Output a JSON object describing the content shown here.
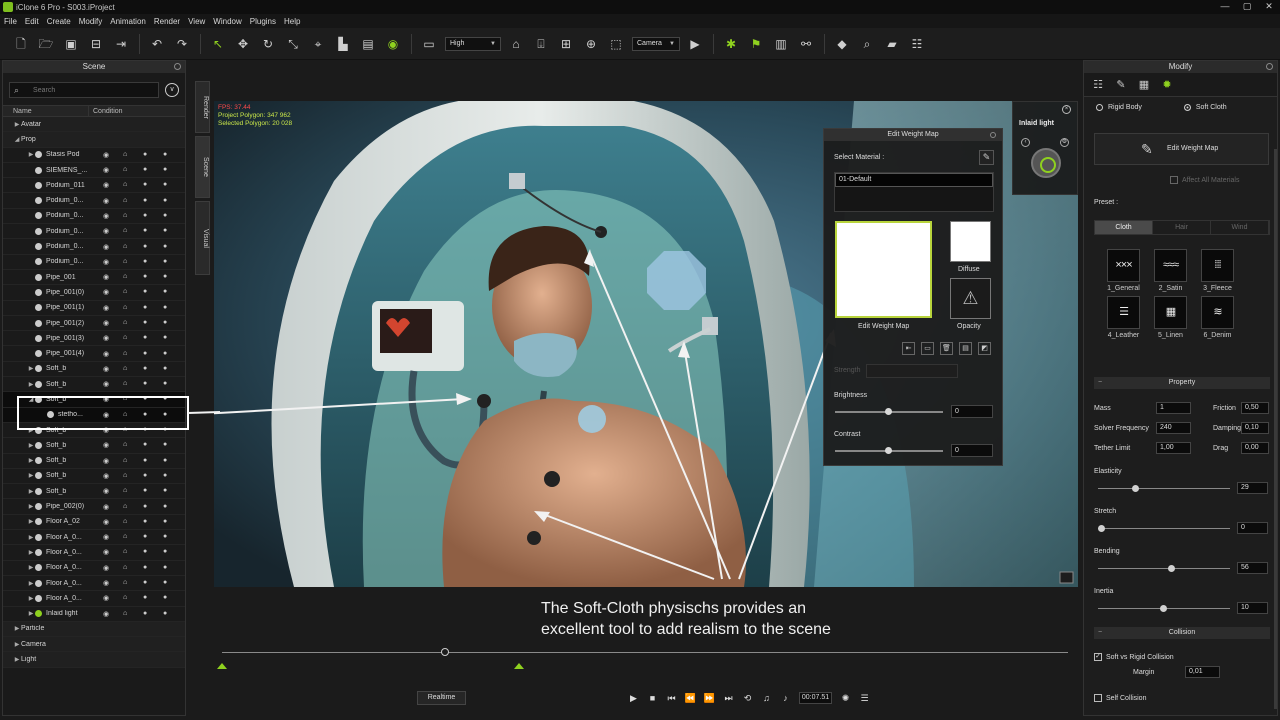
{
  "window": {
    "title": "iClone 6 Pro - S003.iProject",
    "controls": [
      "—",
      "▢",
      "✕"
    ]
  },
  "menu": [
    "File",
    "Edit",
    "Create",
    "Modify",
    "Animation",
    "Render",
    "View",
    "Window",
    "Plugins",
    "Help"
  ],
  "toolbar": {
    "quality": "High",
    "camera": "Camera"
  },
  "scene": {
    "title": "Scene",
    "search_placeholder": "Search",
    "columns": {
      "name": "Name",
      "condition": "Condition"
    },
    "rows": [
      {
        "name": "Avatar",
        "level": 0,
        "type": "category",
        "expanded": false
      },
      {
        "name": "Prop",
        "level": 0,
        "type": "category",
        "expanded": true
      },
      {
        "name": "Stasis Pod",
        "level": 1,
        "type": "item",
        "arrow": "▶"
      },
      {
        "name": "SIEMENS_...",
        "level": 1,
        "type": "item",
        "arrow": ""
      },
      {
        "name": "Podium_011",
        "level": 1,
        "type": "item",
        "arrow": ""
      },
      {
        "name": "Podium_0...",
        "level": 1,
        "type": "item",
        "arrow": ""
      },
      {
        "name": "Podium_0...",
        "level": 1,
        "type": "item",
        "arrow": ""
      },
      {
        "name": "Podium_0...",
        "level": 1,
        "type": "item",
        "arrow": ""
      },
      {
        "name": "Podium_0...",
        "level": 1,
        "type": "item",
        "arrow": ""
      },
      {
        "name": "Podium_0...",
        "level": 1,
        "type": "item",
        "arrow": ""
      },
      {
        "name": "Pipe_001",
        "level": 1,
        "type": "item",
        "arrow": ""
      },
      {
        "name": "Pipe_001(0)",
        "level": 1,
        "type": "item",
        "arrow": ""
      },
      {
        "name": "Pipe_001(1)",
        "level": 1,
        "type": "item",
        "arrow": ""
      },
      {
        "name": "Pipe_001(2)",
        "level": 1,
        "type": "item",
        "arrow": ""
      },
      {
        "name": "Pipe_001(3)",
        "level": 1,
        "type": "item",
        "arrow": ""
      },
      {
        "name": "Pipe_001(4)",
        "level": 1,
        "type": "item",
        "arrow": ""
      },
      {
        "name": "Soft_b",
        "level": 1,
        "type": "item",
        "arrow": "▶"
      },
      {
        "name": "Soft_b",
        "level": 1,
        "type": "item",
        "arrow": "▶"
      },
      {
        "name": "Soft_b",
        "level": 1,
        "type": "item",
        "arrow": "◢",
        "selected": true
      },
      {
        "name": "stetho...",
        "level": 2,
        "type": "item",
        "arrow": "",
        "selected": true
      },
      {
        "name": "Soft_b",
        "level": 1,
        "type": "item",
        "arrow": "▶"
      },
      {
        "name": "Soft_b",
        "level": 1,
        "type": "item",
        "arrow": "▶"
      },
      {
        "name": "Soft_b",
        "level": 1,
        "type": "item",
        "arrow": "▶"
      },
      {
        "name": "Soft_b",
        "level": 1,
        "type": "item",
        "arrow": "▶"
      },
      {
        "name": "Soft_b",
        "level": 1,
        "type": "item",
        "arrow": "▶"
      },
      {
        "name": "Pipe_002(0)",
        "level": 1,
        "type": "item",
        "arrow": "▶"
      },
      {
        "name": "Floor A_02",
        "level": 1,
        "type": "item",
        "arrow": "▶"
      },
      {
        "name": "Floor A_0...",
        "level": 1,
        "type": "item",
        "arrow": "▶"
      },
      {
        "name": "Floor A_0...",
        "level": 1,
        "type": "item",
        "arrow": "▶"
      },
      {
        "name": "Floor A_0...",
        "level": 1,
        "type": "item",
        "arrow": "▶"
      },
      {
        "name": "Floor A_0...",
        "level": 1,
        "type": "item",
        "arrow": "▶"
      },
      {
        "name": "Floor A_0...",
        "level": 1,
        "type": "item",
        "arrow": "▶"
      },
      {
        "name": "Inlaid light",
        "level": 1,
        "type": "item",
        "arrow": "▶",
        "light": true
      },
      {
        "name": "Particle",
        "level": 0,
        "type": "category",
        "expanded": false
      },
      {
        "name": "Camera",
        "level": 0,
        "type": "category",
        "expanded": false
      },
      {
        "name": "Light",
        "level": 0,
        "type": "category",
        "expanded": false
      }
    ]
  },
  "side_tabs": [
    "Render",
    "Scene",
    "Visual"
  ],
  "viewport": {
    "fps": "FPS: 37.44",
    "project_polygons": "Project Polygon: 347 962",
    "selected_polygons": "Selected Polygon: 20 028"
  },
  "inlaid_light": {
    "title": "Inlaid light"
  },
  "edit_weight_map": {
    "title": "Edit Weight Map",
    "select_material": "Select Material :",
    "material": "01-Default",
    "map_label": "Edit Weight Map",
    "diffuse": "Diffuse",
    "opacity": "Opacity",
    "strength": "Strength",
    "brightness_label": "Brightness",
    "brightness_value": "0",
    "contrast_label": "Contrast",
    "contrast_value": "0"
  },
  "annotation": {
    "line1": "The Soft-Cloth physischs provides an",
    "line2": "excellent tool to add realism to the scene"
  },
  "timeline": {
    "realtime": "Realtime",
    "timecode": "00:07.51"
  },
  "modify": {
    "title": "Modify",
    "rigid_body": "Rigid Body",
    "soft_cloth": "Soft Cloth",
    "edit_weight_map": "Edit Weight Map",
    "affect_all": "Affect All Materials",
    "preset_label": "Preset :",
    "preset_tabs": [
      "Cloth",
      "Hair",
      "Wind"
    ],
    "presets": [
      {
        "label": "1_General",
        "glyph": "×××"
      },
      {
        "label": "2_Satin",
        "glyph": "≈≈≈"
      },
      {
        "label": "3_Fleece",
        "glyph": "⁞⁞⁞"
      },
      {
        "label": "4_Leather",
        "glyph": "☰"
      },
      {
        "label": "5_Linen",
        "glyph": "▦"
      },
      {
        "label": "6_Denim",
        "glyph": "≋"
      }
    ],
    "property_header": "Property",
    "mass_label": "Mass",
    "mass": "1",
    "friction_label": "Friction",
    "friction": "0,50",
    "solver_label": "Solver Frequency",
    "solver": "240",
    "damping_label": "Damping",
    "damping": "0,10",
    "tether_label": "Tether Limit",
    "tether": "1,00",
    "drag_label": "Drag",
    "drag": "0,00",
    "elasticity_label": "Elasticity",
    "elasticity": "29",
    "stretch_label": "Stretch",
    "stretch": "0",
    "bending_label": "Bending",
    "bending": "56",
    "inertia_label": "Inertia",
    "inertia": "10",
    "collision_header": "Collision",
    "soft_vs_rigid": "Soft vs Rigid Collision",
    "margin_label": "Margin",
    "margin": "0,01",
    "self_collision": "Self Collision"
  }
}
